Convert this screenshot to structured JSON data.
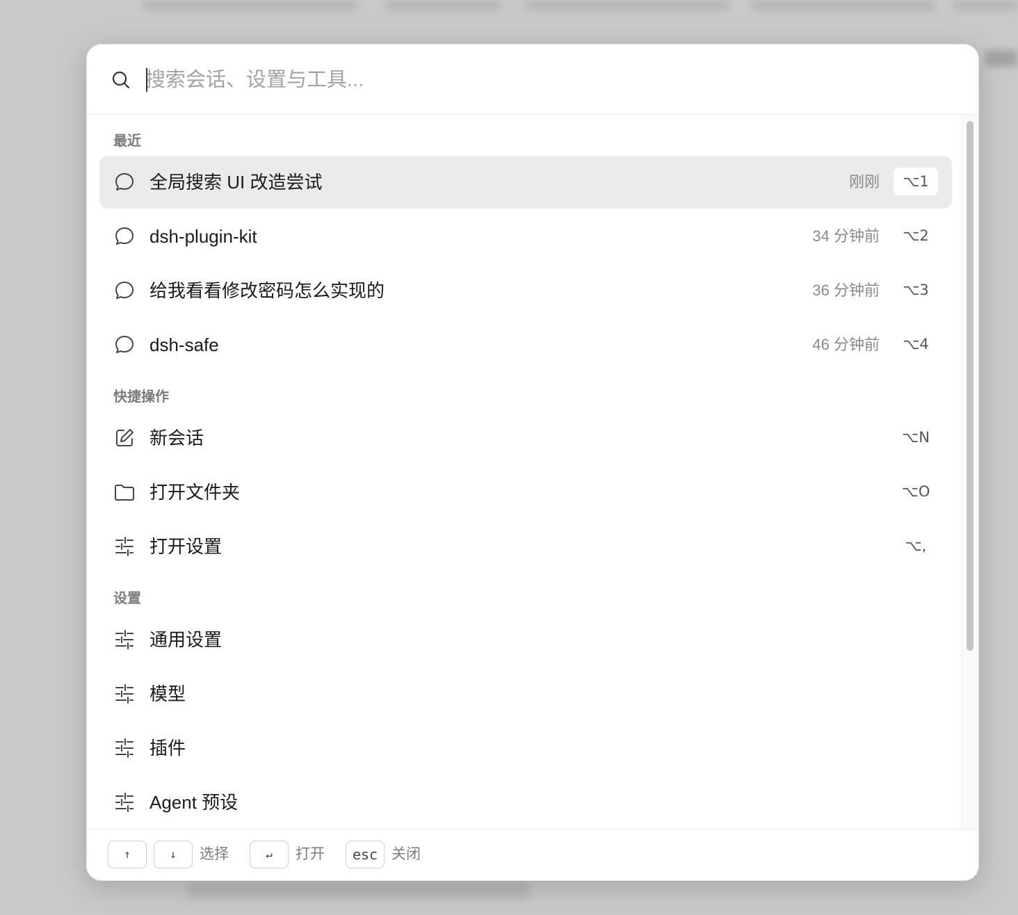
{
  "search": {
    "placeholder": "搜索会话、设置与工具..."
  },
  "sections": {
    "recent": "最近",
    "quick": "快捷操作",
    "settings": "设置"
  },
  "recent_items": [
    {
      "label": "全局搜索 UI 改造尝试",
      "time": "刚刚",
      "shortcut": "⌥1",
      "icon": "chat-bubble-icon",
      "active": true
    },
    {
      "label": "dsh-plugin-kit",
      "time": "34 分钟前",
      "shortcut": "⌥2",
      "icon": "chat-bubble-icon"
    },
    {
      "label": "给我看看修改密码怎么实现的",
      "time": "36 分钟前",
      "shortcut": "⌥3",
      "icon": "chat-bubble-icon"
    },
    {
      "label": "dsh-safe",
      "time": "46 分钟前",
      "shortcut": "⌥4",
      "icon": "chat-bubble-icon"
    }
  ],
  "quick_items": [
    {
      "label": "新会话",
      "shortcut": "⌥N",
      "icon": "edit-icon"
    },
    {
      "label": "打开文件夹",
      "shortcut": "⌥O",
      "icon": "folder-icon"
    },
    {
      "label": "打开设置",
      "shortcut": "⌥,",
      "icon": "sliders-icon"
    }
  ],
  "settings_items": [
    {
      "label": "通用设置",
      "icon": "sliders-icon"
    },
    {
      "label": "模型",
      "icon": "sliders-icon"
    },
    {
      "label": "插件",
      "icon": "sliders-icon"
    },
    {
      "label": "Agent 预设",
      "icon": "sliders-icon"
    }
  ],
  "footer": {
    "up_key": "↑",
    "down_key": "↓",
    "select_label": "选择",
    "enter_key": "↵",
    "open_label": "打开",
    "esc_key": "esc",
    "close_label": "关闭"
  }
}
